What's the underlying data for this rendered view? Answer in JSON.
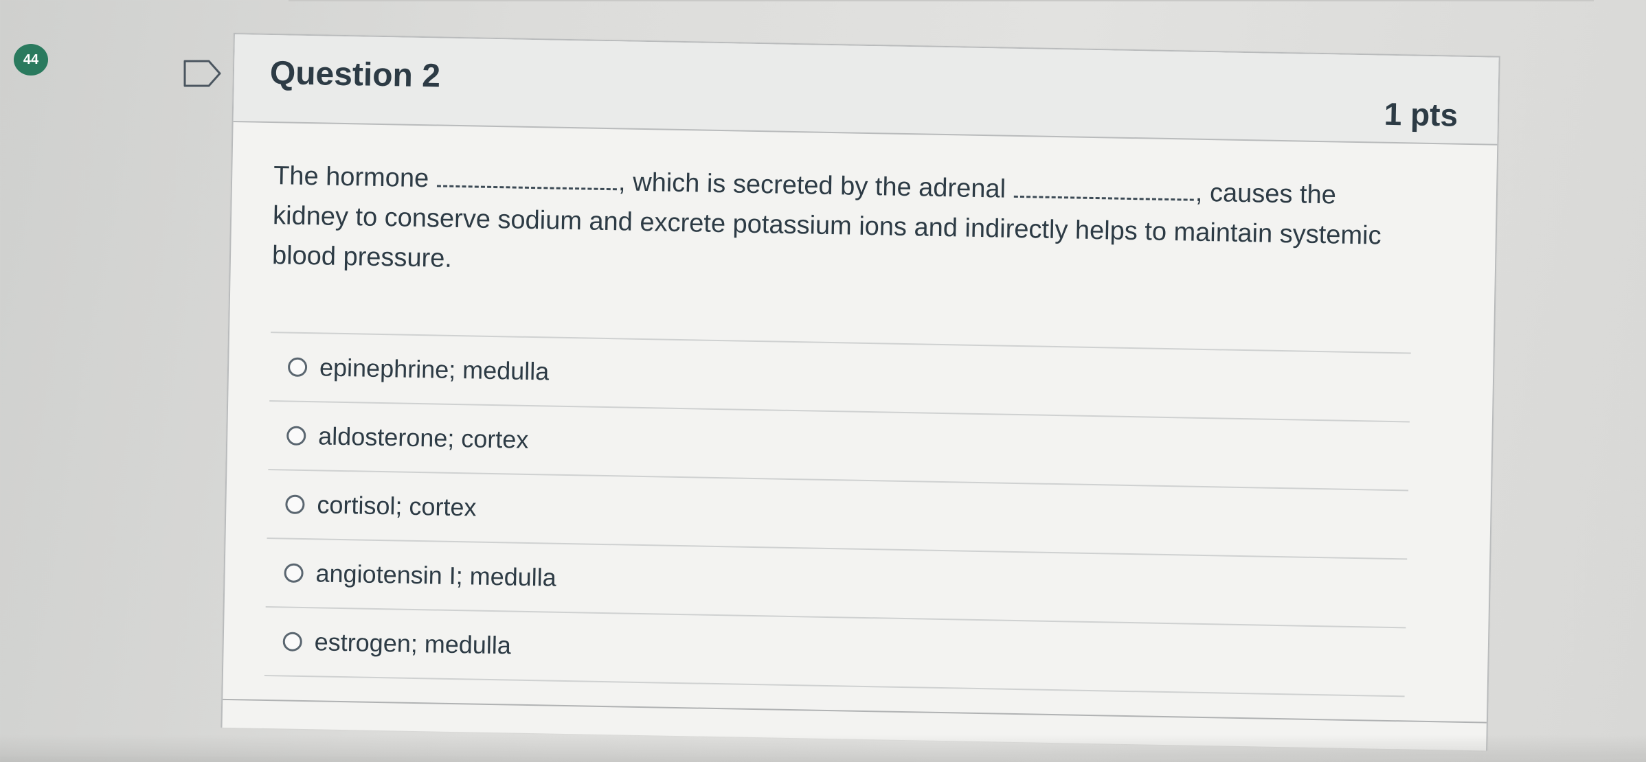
{
  "question_badge": "44",
  "question": {
    "title": "Question 2",
    "points": "1 pts",
    "text_parts": [
      "The hormone",
      ", which is secreted by the adrenal",
      ", causes the kidney to conserve sodium and excrete potassium ions and indirectly helps to maintain systemic blood pressure."
    ],
    "answers": [
      {
        "label": "epinephrine; medulla"
      },
      {
        "label": "aldosterone; cortex"
      },
      {
        "label": "cortisol; cortex"
      },
      {
        "label": "angiotensin I; medulla"
      },
      {
        "label": "estrogen; medulla"
      }
    ]
  },
  "icons": {
    "flag": "bookmark-flag-icon",
    "radio": "radio-button-icon"
  },
  "colors": {
    "badge": "#2a7a5e",
    "text": "#2d3b45",
    "border": "#b9bbbc"
  }
}
